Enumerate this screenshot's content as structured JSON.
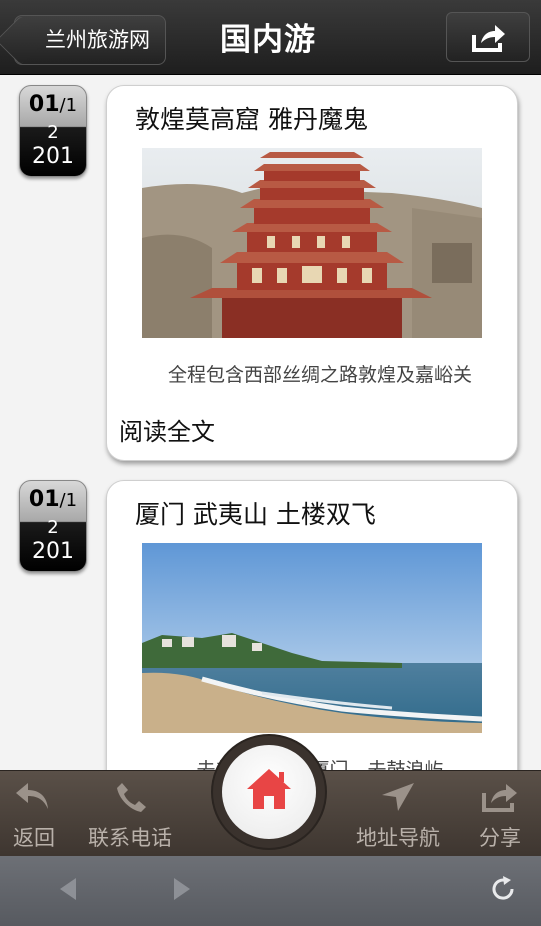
{
  "header": {
    "back_label": "兰州旅游网",
    "title": "国内游",
    "share_icon": "share-icon"
  },
  "entries": [
    {
      "date_main": "01",
      "date_small": "/1",
      "date_mid": "2",
      "date_year": "201",
      "title": "敦煌莫高窟 雅丹魔鬼",
      "image": "mogao-grottoes-photo",
      "description": "全程包含西部丝绸之路敦煌及嘉峪关",
      "read_more": "阅读全文"
    },
    {
      "date_main": "01",
      "date_small": "/1",
      "date_mid": "2",
      "date_year": "201",
      "title": "厦门 武夷山 土楼双飞",
      "image": "xiamen-beach-photo",
      "description": "去美丽的鹭岛厦门，去鼓浪屿"
    }
  ],
  "bottom_bar": {
    "back": "返回",
    "contact": "联系电话",
    "navigate": "地址导航",
    "share": "分享"
  },
  "colors": {
    "header_bg": "#2a2a2a",
    "bottom_bar_bg": "#4b423b",
    "home_icon": "#e84545",
    "browser_bar_bg": "#62656b"
  }
}
